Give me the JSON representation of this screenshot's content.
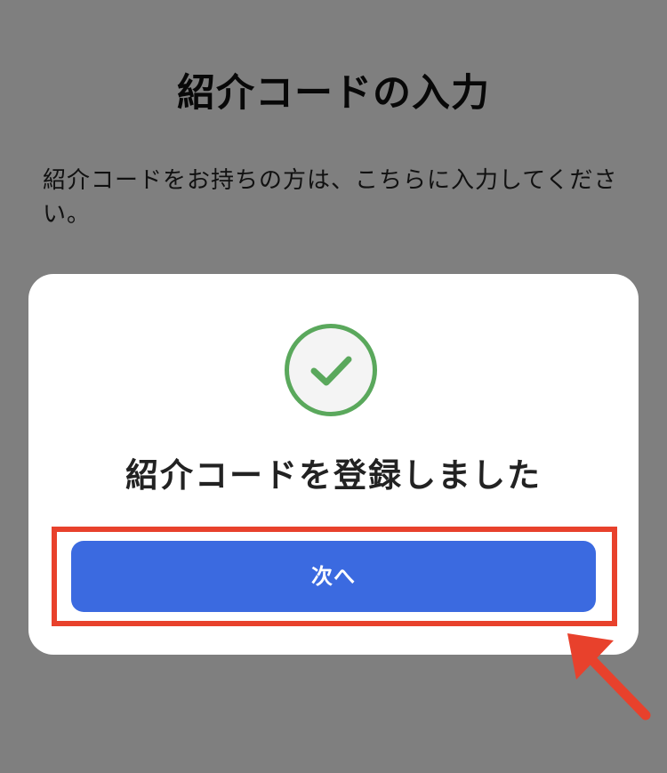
{
  "page": {
    "title": "紹介コードの入力",
    "description": "紹介コードをお持ちの方は、こちらに入力してください。"
  },
  "modal": {
    "icon": "check-circle-icon",
    "message": "紹介コードを登録しました",
    "next_label": "次へ"
  },
  "annotation": {
    "icon": "arrow-pointer-icon"
  },
  "colors": {
    "accent_button": "#3b6ae0",
    "success_green": "#5aa85c",
    "highlight_red": "#e8412c",
    "overlay": "rgba(0,0,0,0.5)"
  }
}
